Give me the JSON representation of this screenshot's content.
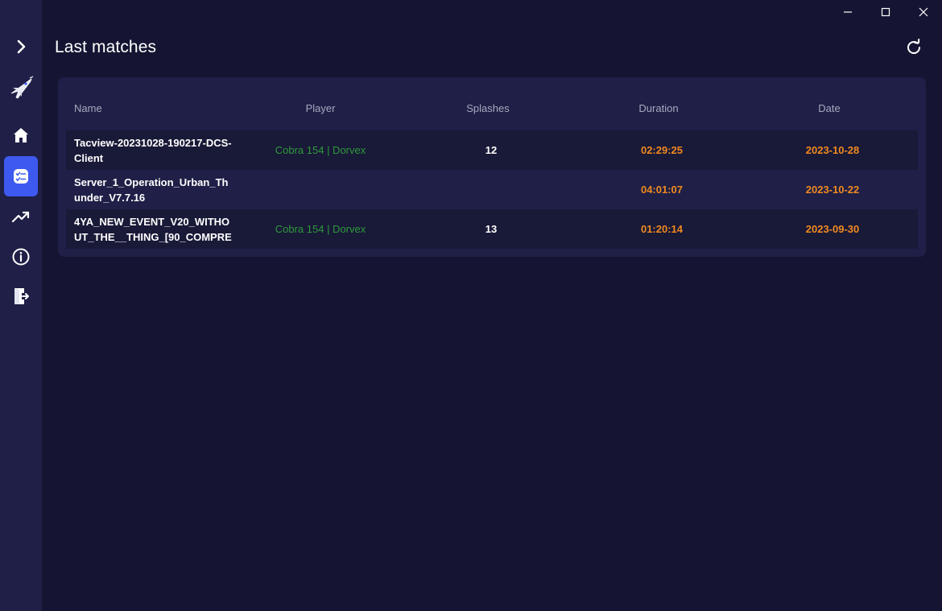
{
  "header": {
    "title": "Last matches"
  },
  "sidebar": {
    "items": [
      {
        "icon": "chevron-right-icon",
        "label": "Expand"
      },
      {
        "icon": "jet-icon",
        "label": "App"
      },
      {
        "icon": "home-icon",
        "label": "Home"
      },
      {
        "icon": "checklist-icon",
        "label": "Matches",
        "active": true
      },
      {
        "icon": "trending-up-icon",
        "label": "Stats"
      },
      {
        "icon": "info-icon",
        "label": "Info"
      },
      {
        "icon": "logout-icon",
        "label": "Logout"
      }
    ]
  },
  "table": {
    "columns": [
      "Name",
      "Player",
      "Splashes",
      "Duration",
      "Date"
    ],
    "rows": [
      {
        "name": "Tacview-20231028-190217-DCS-Client",
        "player": "Cobra 154 | Dorvex",
        "splashes": "12",
        "duration": "02:29:25",
        "date": "2023-10-28"
      },
      {
        "name": "Server_1_Operation_Urban_Thunder_V7.7.16",
        "player": "",
        "splashes": "",
        "duration": "04:01:07",
        "date": "2023-10-22"
      },
      {
        "name": "4YA_NEW_EVENT_V20_WITHOUT_THE__THING_[90_COMPRE",
        "player": "Cobra 154 | Dorvex",
        "splashes": "13",
        "duration": "01:20:14",
        "date": "2023-09-30"
      }
    ]
  },
  "colors": {
    "background": "#151533",
    "sidebar": "#1f1f47",
    "active_accent": "#3e59f0",
    "player_green": "#2e9b3a",
    "orange": "#f08a1f"
  }
}
